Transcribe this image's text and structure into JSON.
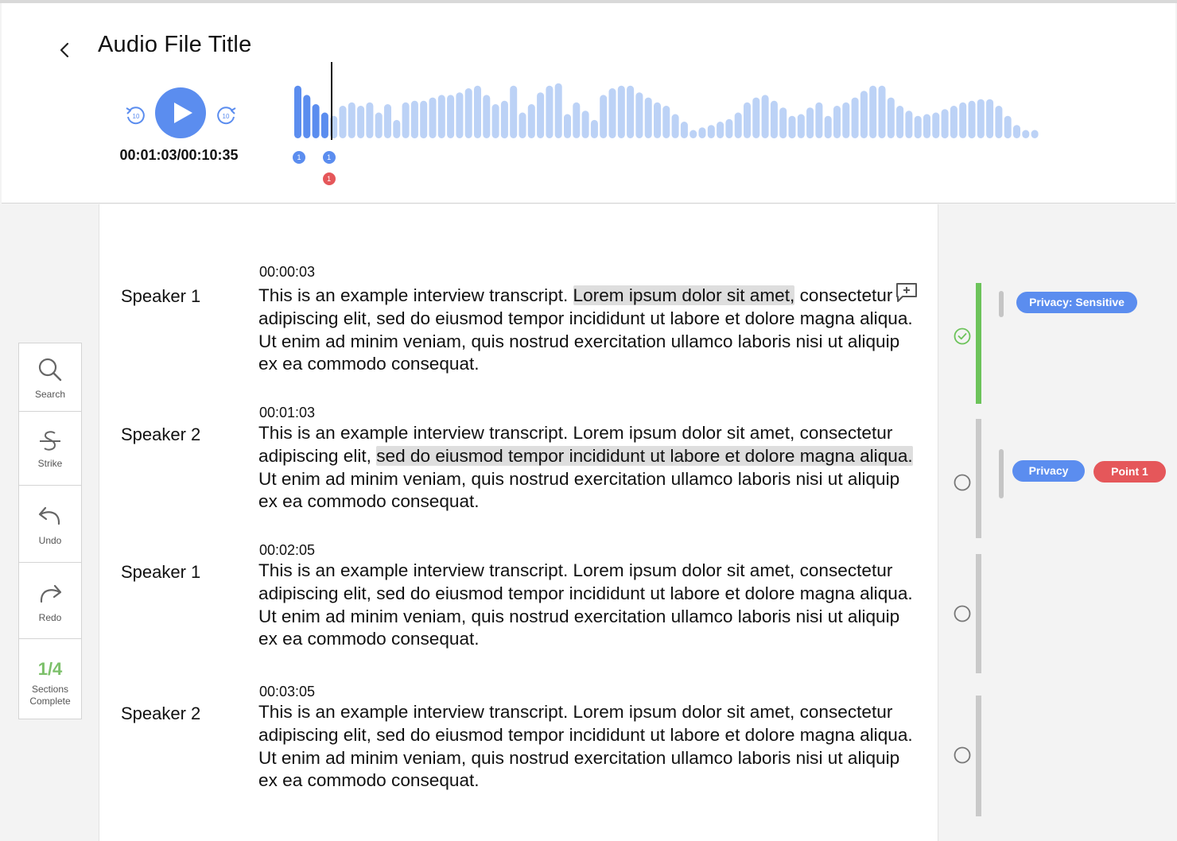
{
  "header": {
    "title": "Audio File Title",
    "time": "00:01:03/00:10:35",
    "skip_seconds": "10"
  },
  "colors": {
    "accent": "#5b8def",
    "waveform_played": "#5b8def",
    "waveform_unplayed": "#bcd2f6",
    "danger": "#e5575a",
    "success": "#6cc35a"
  },
  "waveform": {
    "played_bars": 4,
    "levels": [
      0.63,
      0.52,
      0.41,
      0.31,
      0.27,
      0.39,
      0.43,
      0.39,
      0.43,
      0.31,
      0.41,
      0.22,
      0.43,
      0.45,
      0.45,
      0.49,
      0.52,
      0.52,
      0.55,
      0.6,
      0.63,
      0.52,
      0.41,
      0.45,
      0.63,
      0.31,
      0.41,
      0.55,
      0.63,
      0.66,
      0.29,
      0.43,
      0.33,
      0.22,
      0.52,
      0.6,
      0.63,
      0.63,
      0.55,
      0.49,
      0.43,
      0.39,
      0.29,
      0.2,
      0.1,
      0.13,
      0.16,
      0.2,
      0.23,
      0.31,
      0.43,
      0.49,
      0.52,
      0.45,
      0.37,
      0.27,
      0.29,
      0.37,
      0.43,
      0.27,
      0.39,
      0.43,
      0.49,
      0.57,
      0.63,
      0.63,
      0.49,
      0.39,
      0.33,
      0.27,
      0.29,
      0.31,
      0.35,
      0.39,
      0.43,
      0.45,
      0.47,
      0.47,
      0.39,
      0.27,
      0.16,
      0.1,
      0.1
    ],
    "markers": [
      {
        "label": "1",
        "color": "blue",
        "pos": 0.0
      },
      {
        "label": "1",
        "color": "blue",
        "pos": 0.04
      },
      {
        "label": "1",
        "color": "red",
        "pos": 0.04
      }
    ]
  },
  "toolbar": {
    "search": "Search",
    "strike": "Strike",
    "undo": "Undo",
    "redo": "Redo",
    "progress_count": "1/4",
    "progress_label_line1": "Sections",
    "progress_label_line2": "Complete"
  },
  "segments": [
    {
      "time": "00:00:03",
      "speaker": "Speaker 1",
      "text_before": "This is an example interview transcript. ",
      "text_highlight": "Lorem ipsum dolor sit amet,",
      "text_after": " consectetur adipiscing elit, sed do eiusmod tempor incididunt ut labore et dolore magna aliqua. Ut enim ad minim veniam, quis nostrud exercitation ullamco laboris nisi ut aliquip ex ea commodo consequat."
    },
    {
      "time": "00:01:03",
      "speaker": "Speaker 2",
      "text_before": "This is an example interview transcript. Lorem ipsum dolor sit amet, consectetur adipiscing elit, ",
      "text_highlight": "sed do eiusmod tempor incididunt ut labore et dolore magna aliqua.",
      "text_after": " Ut enim ad minim veniam, quis nostrud exercitation ullamco laboris nisi ut aliquip ex ea commodo consequat."
    },
    {
      "time": "00:02:05",
      "speaker": "Speaker 1",
      "text_before": "This is an example interview transcript. Lorem ipsum dolor sit amet, consectetur adipiscing elit, sed do eiusmod tempor incididunt ut labore et dolore magna aliqua. Ut enim ad minim veniam, quis nostrud exercitation ullamco laboris nisi ut aliquip ex ea commodo consequat.",
      "text_highlight": "",
      "text_after": ""
    },
    {
      "time": "00:03:05",
      "speaker": "Speaker 2",
      "text_before": "This is an example interview transcript. Lorem ipsum dolor sit amet, consectetur adipiscing elit, sed do eiusmod tempor incididunt ut labore et dolore magna aliqua. Ut enim ad minim veniam, quis nostrud exercitation ullamco laboris nisi ut aliquip ex ea commodo consequat.",
      "text_highlight": "",
      "text_after": ""
    }
  ],
  "tags": {
    "section1": [
      "Privacy: Sensitive"
    ],
    "section2": [
      "Privacy",
      "Point 1"
    ]
  }
}
